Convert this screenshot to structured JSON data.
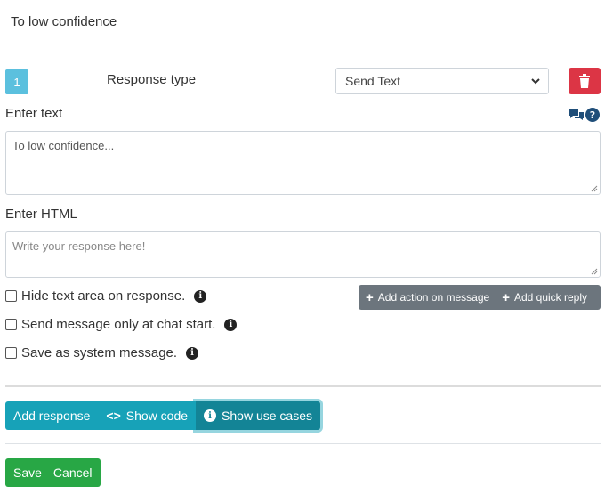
{
  "header": {
    "title": "To low confidence"
  },
  "response": {
    "number": "1",
    "type_label": "Response type",
    "type_value": "Send Text",
    "delete_icon": "trash-icon"
  },
  "text_field": {
    "label": "Enter text",
    "value": "To low confidence...",
    "icons": [
      "chat-icon",
      "help-icon"
    ]
  },
  "html_field": {
    "label": "Enter HTML",
    "placeholder": "Write your response here!"
  },
  "options": {
    "hide_text": "Hide text area on response.",
    "chat_start": "Send message only at chat start.",
    "system_message": "Save as system message."
  },
  "quick_actions": {
    "add_action": "Add action on message",
    "add_quick_reply": "Add quick reply"
  },
  "toolbar": {
    "add_response": "Add response",
    "show_code": "Show code",
    "show_use_cases": "Show use cases"
  },
  "footer": {
    "save": "Save",
    "cancel": "Cancel"
  },
  "colors": {
    "badge": "#5bc0de",
    "danger": "#dc3545",
    "info": "#17a2b8",
    "secondary": "#6c757d",
    "success": "#28a745"
  }
}
